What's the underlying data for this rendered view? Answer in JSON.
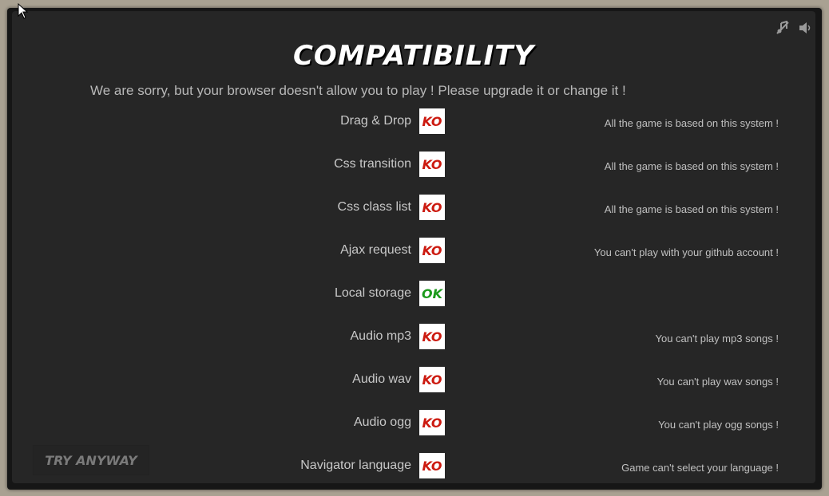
{
  "title": "COMPATIBILITY",
  "message": "We are sorry, but your browser doesn't allow you to play ! Please upgrade it or change it !",
  "colors": {
    "ko": "#cc1a10",
    "ok": "#1c9a1c"
  },
  "features": [
    {
      "label": "Drag & Drop",
      "status": "KO",
      "note": "All the game is based on this system !"
    },
    {
      "label": "Css transition",
      "status": "KO",
      "note": "All the game is based on this system !"
    },
    {
      "label": "Css class list",
      "status": "KO",
      "note": "All the game is based on this system !"
    },
    {
      "label": "Ajax request",
      "status": "KO",
      "note": "You can't play with your github account !"
    },
    {
      "label": "Local storage",
      "status": "OK",
      "note": ""
    },
    {
      "label": "Audio mp3",
      "status": "KO",
      "note": "You can't play mp3 songs !"
    },
    {
      "label": "Audio wav",
      "status": "KO",
      "note": "You can't play wav songs !"
    },
    {
      "label": "Audio ogg",
      "status": "KO",
      "note": "You can't play ogg songs !"
    },
    {
      "label": "Navigator language",
      "status": "KO",
      "note": "Game can't select your language !"
    }
  ],
  "try_button": "TRY ANYWAY",
  "icons": {
    "mute": "music-off-icon",
    "volume": "speaker-icon",
    "cursor": "mouse-pointer-icon"
  }
}
